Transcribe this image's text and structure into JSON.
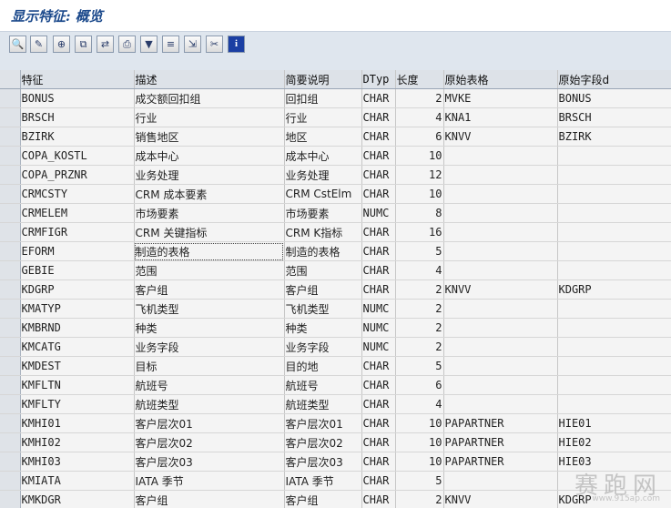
{
  "title": "显示特征: 概览",
  "toolbar": {
    "buttons": [
      {
        "name": "zoom-icon",
        "glyph": "🔍"
      },
      {
        "name": "edit-icon",
        "glyph": "✎"
      },
      {
        "name": "create-icon",
        "glyph": "⊕"
      },
      {
        "name": "copy-icon",
        "glyph": "⧉"
      },
      {
        "name": "move-icon",
        "glyph": "⇄"
      },
      {
        "name": "print-icon",
        "glyph": "⎙"
      },
      {
        "name": "filter-icon",
        "glyph": "▼"
      },
      {
        "name": "sort-icon",
        "glyph": "≡"
      },
      {
        "name": "export-icon",
        "glyph": "⇲"
      },
      {
        "name": "cut-icon",
        "glyph": "✂"
      },
      {
        "name": "info-icon",
        "glyph": "i"
      }
    ]
  },
  "table": {
    "headers": [
      "特征",
      "描述",
      "简要说明",
      "DTyp",
      "长度",
      "原始表格",
      "原始字段d"
    ],
    "rows": [
      [
        "BONUS",
        "成交额回扣组",
        "回扣组",
        "CHAR",
        "2",
        "MVKE",
        "BONUS"
      ],
      [
        "BRSCH",
        "行业",
        "行业",
        "CHAR",
        "4",
        "KNA1",
        "BRSCH"
      ],
      [
        "BZIRK",
        "销售地区",
        "地区",
        "CHAR",
        "6",
        "KNVV",
        "BZIRK"
      ],
      [
        "COPA_KOSTL",
        "成本中心",
        "成本中心",
        "CHAR",
        "10",
        "",
        ""
      ],
      [
        "COPA_PRZNR",
        "业务处理",
        "业务处理",
        "CHAR",
        "12",
        "",
        ""
      ],
      [
        "CRMCSTY",
        "CRM 成本要素",
        "CRM CstElm",
        "CHAR",
        "10",
        "",
        ""
      ],
      [
        "CRMELEM",
        "市场要素",
        "市场要素",
        "NUMC",
        "8",
        "",
        ""
      ],
      [
        "CRMFIGR",
        "CRM 关键指标",
        "CRM K指标",
        "CHAR",
        "16",
        "",
        ""
      ],
      [
        "EFORM",
        "制造的表格",
        "制造的表格",
        "CHAR",
        "5",
        "",
        ""
      ],
      [
        "GEBIE",
        "范围",
        "范围",
        "CHAR",
        "4",
        "",
        ""
      ],
      [
        "KDGRP",
        "客户组",
        "客户组",
        "CHAR",
        "2",
        "KNVV",
        "KDGRP"
      ],
      [
        "KMATYP",
        "飞机类型",
        "飞机类型",
        "NUMC",
        "2",
        "",
        ""
      ],
      [
        "KMBRND",
        "种类",
        "种类",
        "NUMC",
        "2",
        "",
        ""
      ],
      [
        "KMCATG",
        "业务字段",
        "业务字段",
        "NUMC",
        "2",
        "",
        ""
      ],
      [
        "KMDEST",
        "目标",
        "目的地",
        "CHAR",
        "5",
        "",
        ""
      ],
      [
        "KMFLTN",
        "航班号",
        "航班号",
        "CHAR",
        "6",
        "",
        ""
      ],
      [
        "KMFLTY",
        "航班类型",
        "航班类型",
        "CHAR",
        "4",
        "",
        ""
      ],
      [
        "KMHI01",
        "客户层次01",
        "客户层次01",
        "CHAR",
        "10",
        "PAPARTNER",
        "HIE01"
      ],
      [
        "KMHI02",
        "客户层次02",
        "客户层次02",
        "CHAR",
        "10",
        "PAPARTNER",
        "HIE02"
      ],
      [
        "KMHI03",
        "客户层次03",
        "客户层次03",
        "CHAR",
        "10",
        "PAPARTNER",
        "HIE03"
      ],
      [
        "KMIATA",
        "IATA 季节",
        "IATA 季节",
        "CHAR",
        "5",
        "",
        ""
      ],
      [
        "KMKDGR",
        "客户组",
        "客户组",
        "CHAR",
        "2",
        "KNVV",
        "KDGRP"
      ]
    ]
  },
  "watermark": {
    "text": "赛跑网",
    "sub": "www.915ap.com"
  }
}
